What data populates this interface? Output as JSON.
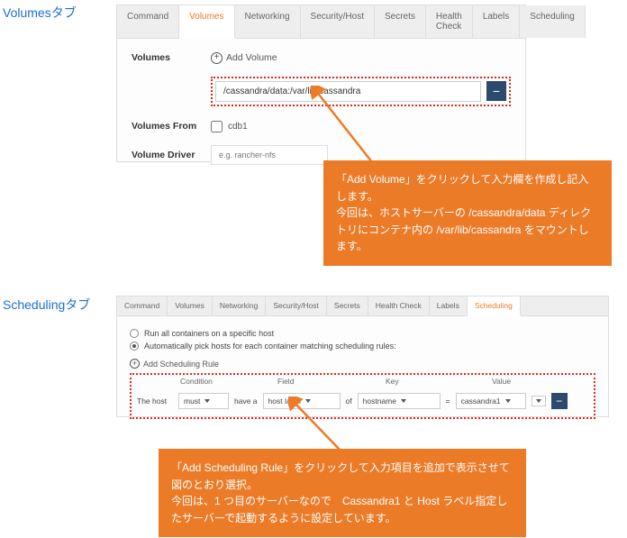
{
  "section1": {
    "label": "Volumesタブ",
    "tabs": [
      "Command",
      "Volumes",
      "Networking",
      "Security/Host",
      "Secrets",
      "Health Check",
      "Labels",
      "Scheduling"
    ],
    "active_tab": 1,
    "volumes_label": "Volumes",
    "add_volume_label": "Add Volume",
    "volume_value": "/cassandra/data:/var/lib/cassandra",
    "volumes_from_label": "Volumes From",
    "volumes_from_item": "cdb1",
    "volume_driver_label": "Volume Driver",
    "volume_driver_placeholder": "e.g. rancher-nfs"
  },
  "callout1": {
    "text": "「Add Volume」をクリックして入力欄を作成し記入します。\n今回は、ホストサーバーの /cassandra/data ディレクトリにコンテナ内の /var/lib/cassandra をマウントします。"
  },
  "section2": {
    "label": "Schedulingタブ",
    "tabs": [
      "Command",
      "Volumes",
      "Networking",
      "Security/Host",
      "Secrets",
      "Health Check",
      "Labels",
      "Scheduling"
    ],
    "active_tab": 7,
    "radio1": "Run all containers on a specific host",
    "radio2": "Automatically pick hosts for each container matching scheduling rules:",
    "add_rule_label": "Add Scheduling Rule",
    "headers": {
      "condition": "Condition",
      "field": "Field",
      "key": "Key",
      "value": "Value"
    },
    "rule": {
      "prefix": "The host",
      "condition": "must",
      "mid1": "have a",
      "field": "host label",
      "mid2": "of",
      "key": "hostname",
      "eq": "=",
      "value": "cassandra1"
    }
  },
  "callout2": {
    "text": "「Add Scheduling Rule」をクリックして入力項目を追加で表示させて図のとおり選択。\n今回は、1 つ目のサーバーなので　Cassandra1 と Host ラベル指定したサーバーで起動するように設定しています。"
  }
}
